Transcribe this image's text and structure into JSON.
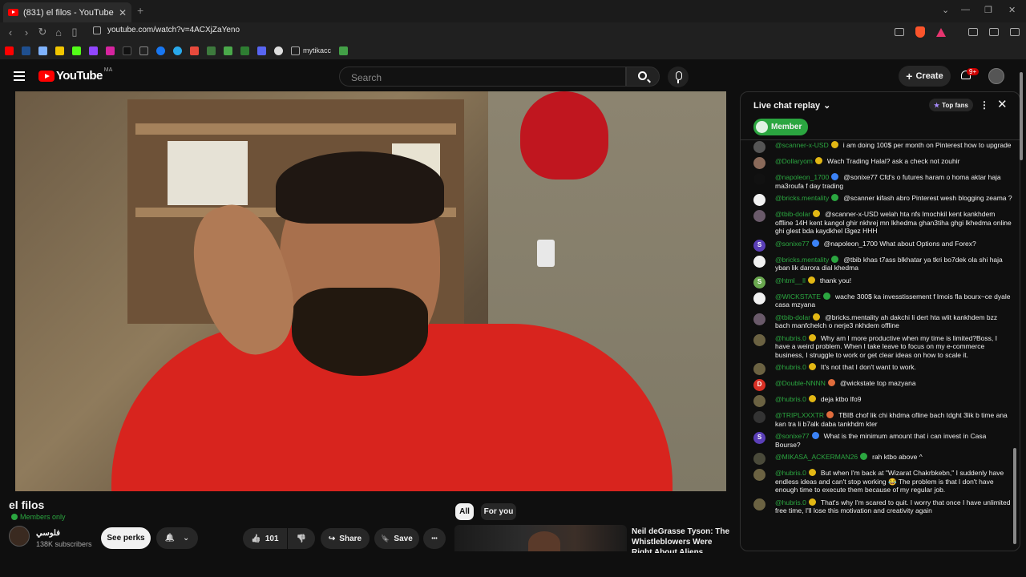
{
  "browser": {
    "tab_title": "(831) el filos - YouTube",
    "tab_close": "✕",
    "new_tab": "+",
    "url": "youtube.com/watch?v=4ACXjZaYeno",
    "bookmark_folder": "mytikacc",
    "nav": {
      "back": "‹",
      "forward": "›",
      "reload": "↻"
    },
    "window": {
      "chevron": "⌄",
      "minimize": "—",
      "restore": "❐",
      "close": "✕"
    }
  },
  "header": {
    "logo_text": "YouTube",
    "country": "MA",
    "search_placeholder": "Search",
    "create_label": "Create",
    "create_plus": "+",
    "notification_badge": "9+"
  },
  "video": {
    "title": "el filos",
    "members_only": "Members only",
    "channel_name": "فلوسي",
    "subscribers": "138K subscribers",
    "see_perks": "See perks",
    "bell": "🔔",
    "chevron": "⌄",
    "likes": "101",
    "like_icon": "👍",
    "dislike_icon": "👎",
    "share": "Share",
    "share_icon": "↪",
    "save": "Save",
    "save_icon": "🔖",
    "more": "•••"
  },
  "recommendations": {
    "chips": [
      "All",
      "For you"
    ],
    "items": [
      {
        "title": "Neil deGrasse Tyson: The Whistleblowers Were Right About Aliens"
      }
    ]
  },
  "chat": {
    "title": "Live chat replay",
    "chevron": "⌄",
    "top_fans": "Top fans",
    "top_fans_star": "★",
    "more": "⋮",
    "close": "✕",
    "member_filter": "Member",
    "messages": [
      {
        "author": "@scanner-x-USD",
        "text": "i am doing 100$ per month on Pinterest how to upgrade",
        "avatar_color": "#555555",
        "avatar_letter": "",
        "badge_color": "#e2b714"
      },
      {
        "author": "@Dollaryom",
        "text": "Wach Trading Halal? ask a check not zouhir",
        "avatar_color": "#8a6a5a",
        "avatar_letter": "",
        "badge_color": "#e2b714"
      },
      {
        "author": "@napoleon_1700",
        "text": "@sonixe77 Cfd's o futures haram o homa aktar haja ma3roufa f day trading",
        "avatar_color": "#111111",
        "avatar_letter": "",
        "badge_color": "#3b82f6"
      },
      {
        "author": "@bricks.mentality",
        "text": "@scanner kifash abro Pinterest wesh blogging zeama ?",
        "avatar_color": "#f1f1f1",
        "avatar_letter": "",
        "badge_color": "#2ba640"
      },
      {
        "author": "@tbib-dolar",
        "text": "@scanner-x-USD welah hta nfs lmochkil kent kankhdem offline 14H kent kangol ghir nkhrej mn lkhedma ghan3tiha ghgi lkhedma online ghi glest bda kaydkhel l3gez HHH",
        "avatar_color": "#6a5a6a",
        "avatar_letter": "",
        "badge_color": "#e2b714"
      },
      {
        "author": "@sonixe77",
        "text": "@napoleon_1700 What about Options and Forex?",
        "avatar_color": "#5b3fb8",
        "avatar_letter": "S",
        "badge_color": "#3b82f6"
      },
      {
        "author": "@bricks.mentality",
        "text": "@tbib khas t7ass blkhatar ya tkri bo7dek ola shi haja yban lik darora dial khedma",
        "avatar_color": "#f1f1f1",
        "avatar_letter": "",
        "badge_color": "#2ba640"
      },
      {
        "author": "@html__ll",
        "text": "thank you!",
        "avatar_color": "#6aa84f",
        "avatar_letter": "S",
        "badge_color": "#e2b714"
      },
      {
        "author": "@WICKSTATE",
        "text": "wache 300$ ka invesstissement f lmois fla bourx~ce dyale casa mzyana",
        "avatar_color": "#f1f1f1",
        "avatar_letter": "",
        "badge_color": "#2ba640"
      },
      {
        "author": "@tbib-dolar",
        "text": "@bricks.mentality ah dakchi li dert hta wlit kankhdem bzz bach manfchelch o nerje3 nkhdem offline",
        "avatar_color": "#6a5a6a",
        "avatar_letter": "",
        "badge_color": "#e2b714"
      },
      {
        "author": "@hubris.0",
        "text": "Why am I more productive when my time is limited?Boss, I have a weird problem. When I take leave to focus on my e-commerce business, I struggle to work or get clear ideas on how to scale it.",
        "avatar_color": "#6b6242",
        "avatar_letter": "",
        "badge_color": "#e2b714"
      },
      {
        "author": "@hubris.0",
        "text": "It's not that I don't want to work.",
        "avatar_color": "#6b6242",
        "avatar_letter": "",
        "badge_color": "#e2b714"
      },
      {
        "author": "@Double-NNNN",
        "text": "@wickstate top mazyana",
        "avatar_color": "#d93025",
        "avatar_letter": "D",
        "badge_color": "#e06c3c"
      },
      {
        "author": "@hubris.0",
        "text": "deja ktbo lfo9",
        "avatar_color": "#6b6242",
        "avatar_letter": "",
        "badge_color": "#e2b714"
      },
      {
        "author": "@TRIPLXXXTR",
        "text": "TBIB chof lik chi khdma ofline bach tdght 3lik b time ana kan tra li b7alk daba tankhdm kter",
        "avatar_color": "#333333",
        "avatar_letter": "",
        "badge_color": "#e06c3c"
      },
      {
        "author": "@sonixe77",
        "text": "What is the minimum amount that i can invest in Casa Bourse?",
        "avatar_color": "#5b3fb8",
        "avatar_letter": "S",
        "badge_color": "#3b82f6"
      },
      {
        "author": "@MIKASA_ACKERMAN26",
        "text": "rah ktbo above ^",
        "avatar_color": "#4a4a3a",
        "avatar_letter": "",
        "badge_color": "#2ba640"
      },
      {
        "author": "@hubris.0",
        "text": "But when I'm back at \"Wizarat Chakrbkebn,\" I suddenly have endless ideas and can't stop working 😂 The problem is that I don't have enough time to execute them because of my regular job.",
        "avatar_color": "#6b6242",
        "avatar_letter": "",
        "badge_color": "#e2b714"
      },
      {
        "author": "@hubris.0",
        "text": "That's why I'm scared to quit. I worry that once I have unlimited free time, I'll lose this motivation and creativity again",
        "avatar_color": "#6b6242",
        "avatar_letter": "",
        "badge_color": "#e2b714"
      }
    ]
  }
}
